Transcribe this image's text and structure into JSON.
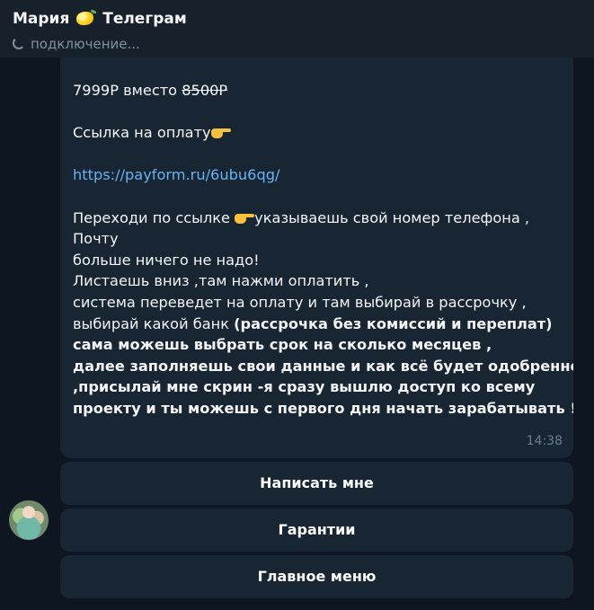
{
  "header": {
    "name": "Мария",
    "app": "Телеграм",
    "status": "подключение..."
  },
  "message": {
    "price_new": "7999Р",
    "price_word": "вместо",
    "price_old": "8500Р",
    "pay_label": "Ссылка на оплату",
    "link": "https://payform.ru/6ubu6qg/",
    "lines": [
      "Переходи по ссылке",
      "указываешь свой номер телефона ,",
      "Почту",
      "больше ничего не надо!",
      "Листаешь вниз ,там нажми оплатить ,",
      "система переведет на оплату и там выбирай в рассрочку ,",
      "выбирай какой банк ",
      "(рассрочка без комиссий и переплат)",
      "сама можешь выбрать срок на сколько месяцев ,",
      "далее заполняешь свои данные и как всё будет одобренно",
      ",присылай мне скрин -я сразу вышлю доступ ко всему",
      "проекту и ты можешь с первого дня начать зарабатывать !"
    ],
    "time": "14:38"
  },
  "keyboard": {
    "button1": "Написать мне",
    "button2": "Гарантии",
    "button3": "Главное меню"
  },
  "icons": {
    "emoji": "lemon-icon",
    "pointing": "pointing-right-icon",
    "connecting": "spinner-icon"
  },
  "colors": {
    "background": "#0e1621",
    "header": "#17212b",
    "bubble": "#182533",
    "link": "#6ab2f2",
    "muted": "#7f91a4"
  }
}
